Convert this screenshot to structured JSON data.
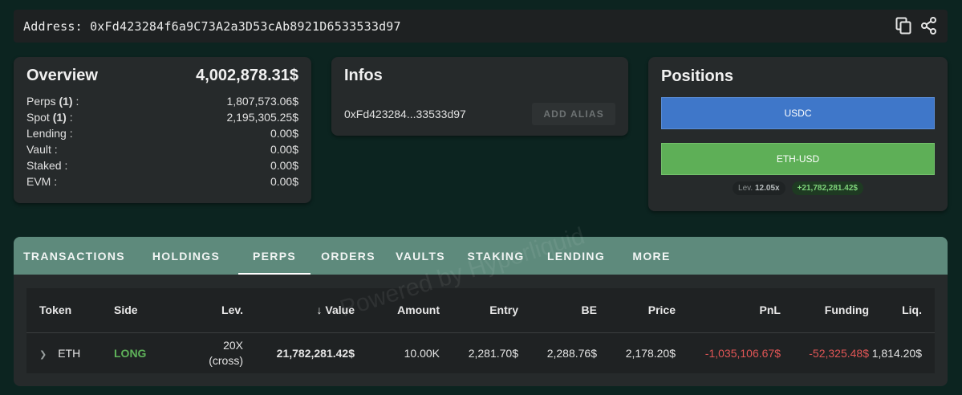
{
  "address_bar": {
    "label": "Address: 0xFd423284f6a9C73A2a3D53cAb8921D6533533d97",
    "copy_icon": "copy-icon",
    "share_icon": "share-icon"
  },
  "overview": {
    "title": "Overview",
    "total": "4,002,878.31$",
    "rows": [
      {
        "label": "Perps",
        "count": "(1)",
        "suffix": " :",
        "value": "1,807,573.06$"
      },
      {
        "label": "Spot",
        "count": "(1)",
        "suffix": " :",
        "value": "2,195,305.25$"
      },
      {
        "label": "Lending :",
        "count": "",
        "suffix": "",
        "value": "0.00$"
      },
      {
        "label": "Vault :",
        "count": "",
        "suffix": "",
        "value": "0.00$"
      },
      {
        "label": "Staked :",
        "count": "",
        "suffix": "",
        "value": "0.00$"
      },
      {
        "label": "EVM :",
        "count": "",
        "suffix": "",
        "value": "0.00$"
      }
    ]
  },
  "infos": {
    "title": "Infos",
    "short_address": "0xFd423284...33533d97",
    "add_alias_label": "ADD ALIAS"
  },
  "positions": {
    "title": "Positions",
    "usdc_label": "USDC",
    "eth_label": "ETH-USD",
    "lev_label": "Lev.",
    "lev_value": "12.05x",
    "pnl_value": "+21,782,281.42$"
  },
  "tabs": [
    {
      "label": "TRANSACTIONS"
    },
    {
      "label": "HOLDINGS"
    },
    {
      "label": "PERPS"
    },
    {
      "label": "ORDERS"
    },
    {
      "label": "VAULTS"
    },
    {
      "label": "STAKING"
    },
    {
      "label": "LENDING"
    },
    {
      "label": "MORE"
    }
  ],
  "table": {
    "headers": {
      "token": "Token",
      "side": "Side",
      "lev": "Lev.",
      "value": "Value",
      "amount": "Amount",
      "entry": "Entry",
      "be": "BE",
      "price": "Price",
      "pnl": "PnL",
      "funding": "Funding",
      "liq": "Liq."
    },
    "row": {
      "token": "ETH",
      "side": "LONG",
      "lev_top": "20X",
      "lev_bottom": "(cross)",
      "value": "21,782,281.42$",
      "amount": "10.00K",
      "entry": "2,281.70$",
      "be": "2,288.76$",
      "price": "2,178.20$",
      "pnl": "-1,035,106.67$",
      "funding": "-52,325.48$",
      "liq": "1,814.20$"
    }
  },
  "watermark": "Powered by Hyperliquid",
  "colors": {
    "background": "#0c2420",
    "card": "#262a2b",
    "tab_bar": "#5e8a7c",
    "usdc_bar": "#3f77c9",
    "eth_bar": "#5eaf57",
    "long": "#5fb35a",
    "negative": "#e05555"
  }
}
